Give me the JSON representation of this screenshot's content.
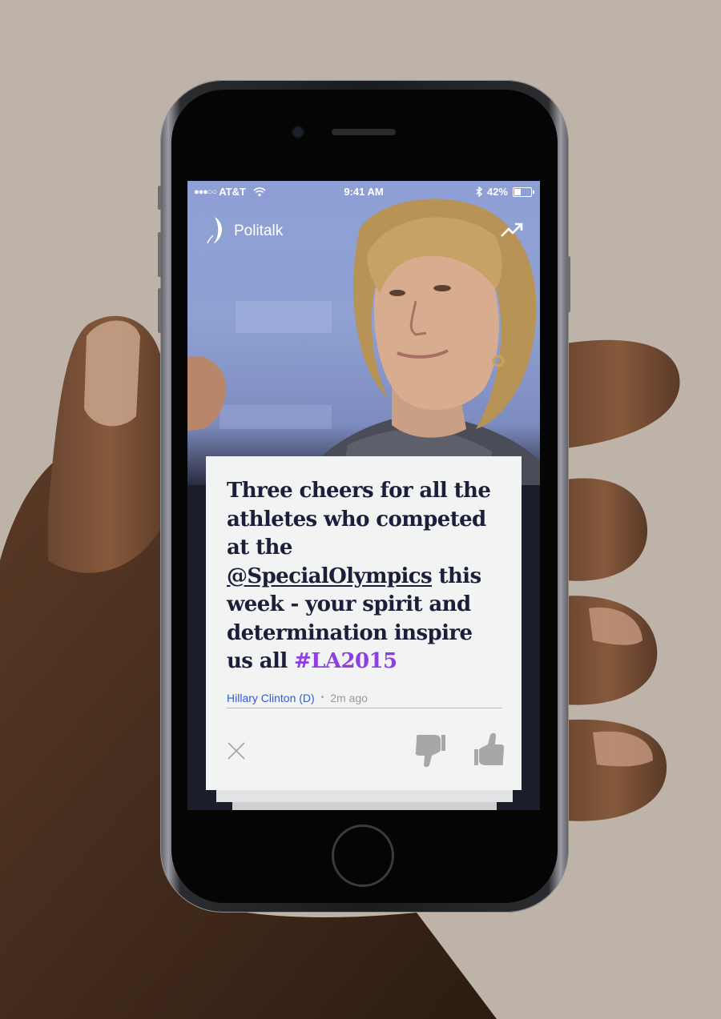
{
  "status_bar": {
    "signal": "●●●○○",
    "carrier": "AT&T",
    "time": "9:41 AM",
    "battery": "42%",
    "battery_level": 0.42
  },
  "app": {
    "title": "Politalk"
  },
  "card": {
    "tweet_start": "Three cheers for all the athletes who competed at the ",
    "mention": "@SpecialOlympics",
    "tweet_middle": " this week - your spirit and determination inspire us all ",
    "hashtag": "#LA2015",
    "author": "Hillary Clinton (D)",
    "separator": "•",
    "time_ago": "2m ago"
  },
  "colors": {
    "background": "#beb3a9",
    "hashtag": "#8e3ee3",
    "author_link": "#2e5bd8",
    "tweet_text": "#1e1d3a"
  }
}
